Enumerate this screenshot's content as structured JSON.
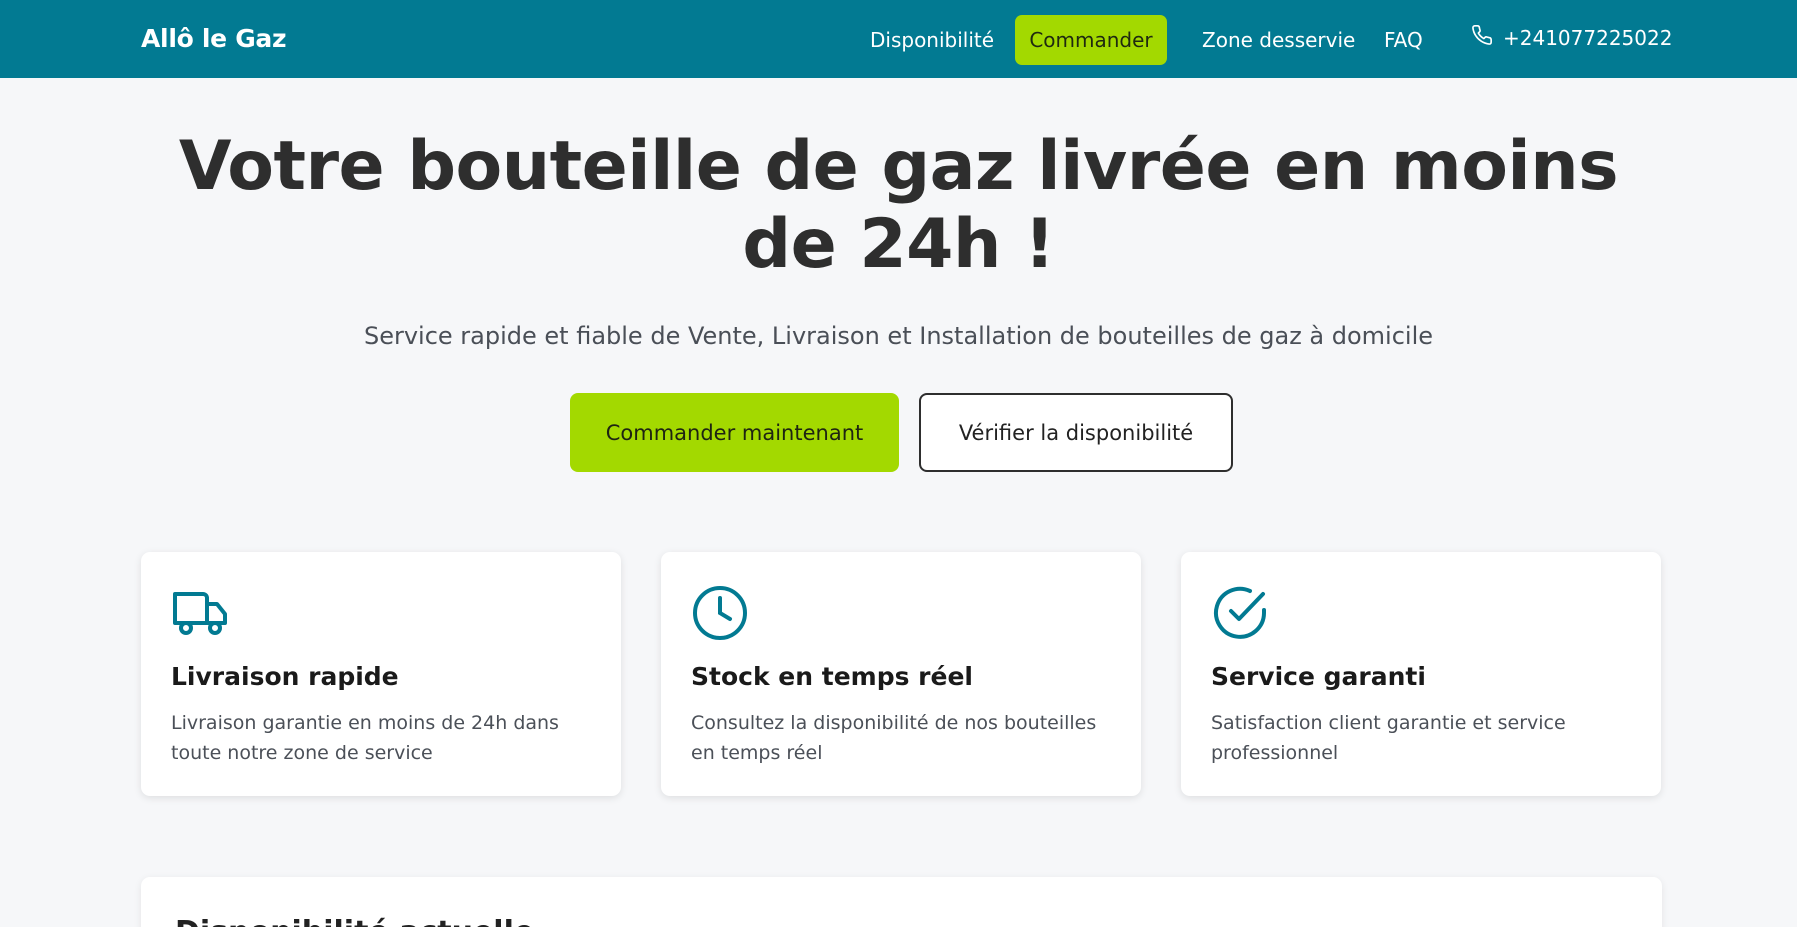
{
  "brand": "Allô le Gaz",
  "nav": {
    "links": [
      "Disponibilité",
      "Commander",
      "Zone desservie",
      "FAQ"
    ],
    "phone": "+241077225022"
  },
  "hero": {
    "title_line1": "Votre bouteille de gaz livrée en moins",
    "title_line2": "de 24h !",
    "subtitle": "Service rapide et fiable de Vente, Livraison et Installation de bouteilles de gaz à domicile",
    "primary_button": "Commander maintenant",
    "secondary_button": "Vérifier la disponibilité"
  },
  "features": [
    {
      "icon": "truck-icon",
      "title": "Livraison rapide",
      "text": "Livraison garantie en moins de 24h dans toute notre zone de service"
    },
    {
      "icon": "clock-icon",
      "title": "Stock en temps réel",
      "text": "Consultez la disponibilité de nos bouteilles en temps réel"
    },
    {
      "icon": "check-circle-icon",
      "title": "Service garanti",
      "text": "Satisfaction client garantie et service professionnel"
    }
  ],
  "next_section": {
    "title": "Disponibilité actuelle"
  },
  "colors": {
    "primary": "#027a92",
    "accent": "#a3d900",
    "background": "#f6f7f9",
    "text": "#2e2e2e"
  }
}
